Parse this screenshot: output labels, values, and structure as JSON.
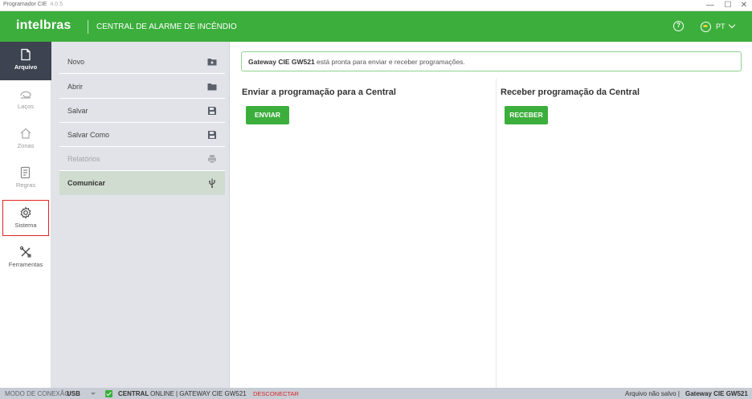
{
  "window": {
    "app_name": "Programador CIE",
    "version": "4.0.5",
    "minimize": "—",
    "maximize": "☐",
    "close": "✕"
  },
  "header": {
    "logo": "intelbras",
    "title": "CENTRAL DE ALARME DE INCÊNDIO",
    "help": "?",
    "language": "PT"
  },
  "nav": {
    "items": [
      {
        "label": "Arquivo",
        "icon": "file-icon"
      },
      {
        "label": "Laços",
        "icon": "loop-icon"
      },
      {
        "label": "Zonas",
        "icon": "home-icon"
      },
      {
        "label": "Regras",
        "icon": "rules-icon"
      },
      {
        "label": "Sistema",
        "icon": "gear-icon"
      },
      {
        "label": "Ferramentas",
        "icon": "tools-icon"
      }
    ]
  },
  "submenu": {
    "items": [
      {
        "label": "Novo",
        "icon": "folder-plus-icon"
      },
      {
        "label": "Abrir",
        "icon": "folder-icon"
      },
      {
        "label": "Salvar",
        "icon": "save-icon"
      },
      {
        "label": "Salvar Como",
        "icon": "save-as-icon"
      },
      {
        "label": "Relatórios",
        "icon": "printer-icon"
      },
      {
        "label": "Comunicar",
        "icon": "usb-icon"
      }
    ]
  },
  "main": {
    "banner_device": "Gateway CIE GW521",
    "banner_text": "está pronta para enviar e receber programações.",
    "send_title": "Enviar a programação para a Central",
    "send_button": "ENVIAR",
    "receive_title": "Receber programação da Central",
    "receive_button": "RECEBER"
  },
  "status": {
    "mode_label": "MODO DE CONEXÃO",
    "mode_value": "USB",
    "central_label": "CENTRAL",
    "online_text": "ONLINE | GATEWAY CIE GW521",
    "disconnect": "DESCONECTAR",
    "file_status": "Arquivo não salvo |",
    "device": "Gateway CIE GW521"
  },
  "colors": {
    "brand_green": "#3cae3c",
    "nav_active": "#3d4350",
    "highlight_red": "#e02424"
  }
}
